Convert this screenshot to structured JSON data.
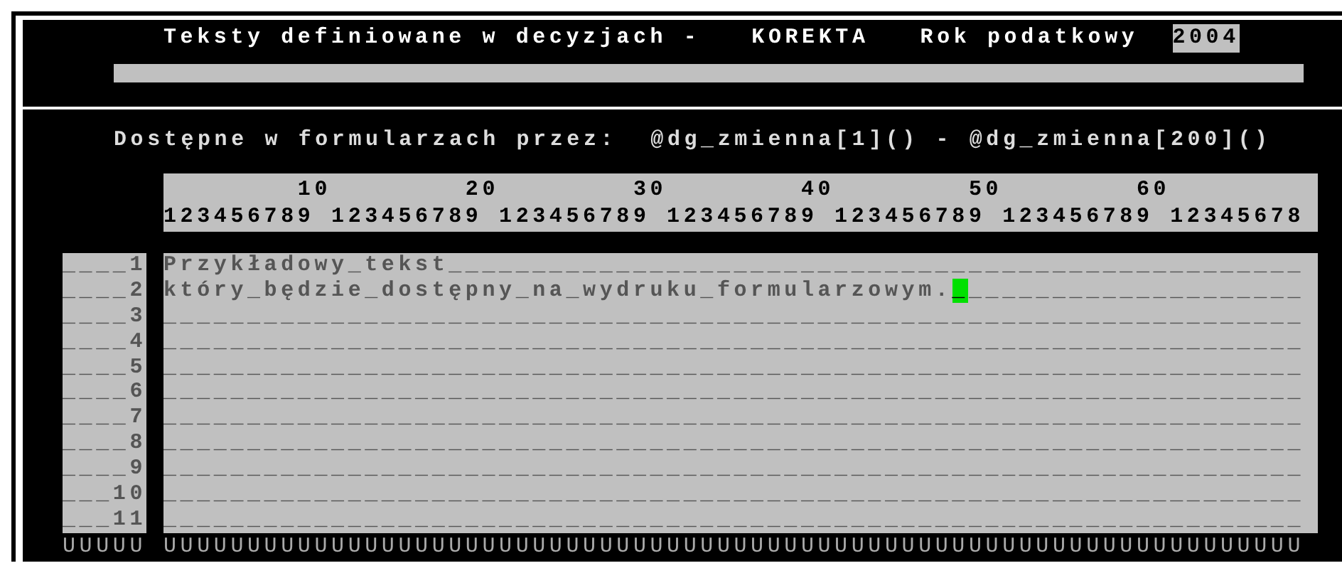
{
  "header": {
    "title": "Teksty definiowane w decyzjach -",
    "mode": "KOREKTA",
    "year_label": "Rok podatkowy",
    "year": "2004"
  },
  "info": "Dostępne w formularzach przez:  @dg_zmienna[1]() - @dg_zmienna[200]()",
  "ruler": [
    "        10        20        30        40        50        60",
    "123456789 123456789 123456789 123456789 123456789 123456789 12345678"
  ],
  "rows": [
    {
      "number": "____1",
      "text": "Przykładowy_tekst___________________________________________________",
      "cursor": "",
      "tail": ""
    },
    {
      "number": "____2",
      "text": "który_będzie_dostępny_na_wydruku_formularzowym.",
      "cursor": "_",
      "tail": "____________________"
    },
    {
      "number": "____3",
      "text": "____________________________________________________________________",
      "cursor": "",
      "tail": ""
    },
    {
      "number": "____4",
      "text": "____________________________________________________________________",
      "cursor": "",
      "tail": ""
    },
    {
      "number": "____5",
      "text": "____________________________________________________________________",
      "cursor": "",
      "tail": ""
    },
    {
      "number": "____6",
      "text": "____________________________________________________________________",
      "cursor": "",
      "tail": ""
    },
    {
      "number": "____7",
      "text": "____________________________________________________________________",
      "cursor": "",
      "tail": ""
    },
    {
      "number": "____8",
      "text": "____________________________________________________________________",
      "cursor": "",
      "tail": ""
    },
    {
      "number": "____9",
      "text": "____________________________________________________________________",
      "cursor": "",
      "tail": ""
    },
    {
      "number": "___10",
      "text": "____________________________________________________________________",
      "cursor": "",
      "tail": ""
    },
    {
      "number": "___11",
      "text": "____________________________________________________________________",
      "cursor": "",
      "tail": ""
    }
  ],
  "footer": {
    "numbers": "UUUUU",
    "text": "UUUUUUUUUUUUUUUUUUUUUUUUUUUUUUUUUUUUUUUUUUUUUUUUUUUUUUUUUUUUUUUUUUUU"
  }
}
